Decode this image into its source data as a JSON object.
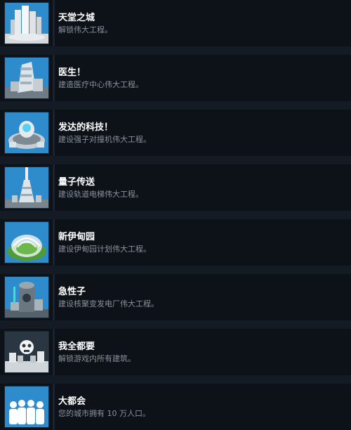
{
  "achievements": [
    {
      "title": "天堂之城",
      "description": "解锁伟大工程。",
      "icon": "skyscraper-cluster-icon"
    },
    {
      "title": "医生！",
      "description": "建造医疗中心伟大工程。",
      "icon": "medical-center-icon"
    },
    {
      "title": "发达的科技！",
      "description": "建设强子对撞机伟大工程。",
      "icon": "hadron-collider-icon"
    },
    {
      "title": "量子传送",
      "description": "建设轨道电梯伟大工程。",
      "icon": "space-elevator-icon"
    },
    {
      "title": "新伊甸园",
      "description": "建设伊甸园计划伟大工程。",
      "icon": "eden-dome-icon"
    },
    {
      "title": "急性子",
      "description": "建设核聚变发电厂伟大工程。",
      "icon": "fusion-plant-icon"
    },
    {
      "title": "我全都要",
      "description": "解锁游戏内所有建筑。",
      "icon": "all-buildings-icon"
    },
    {
      "title": "大都会",
      "description": "您的城市拥有 10 万人口。",
      "icon": "population-icon"
    }
  ],
  "colors": {
    "row_bg": "#0d1118",
    "page_bg": "#151b24",
    "title": "#ffffff",
    "description": "#8b929a",
    "icon_sky": "#2c8fcf"
  }
}
